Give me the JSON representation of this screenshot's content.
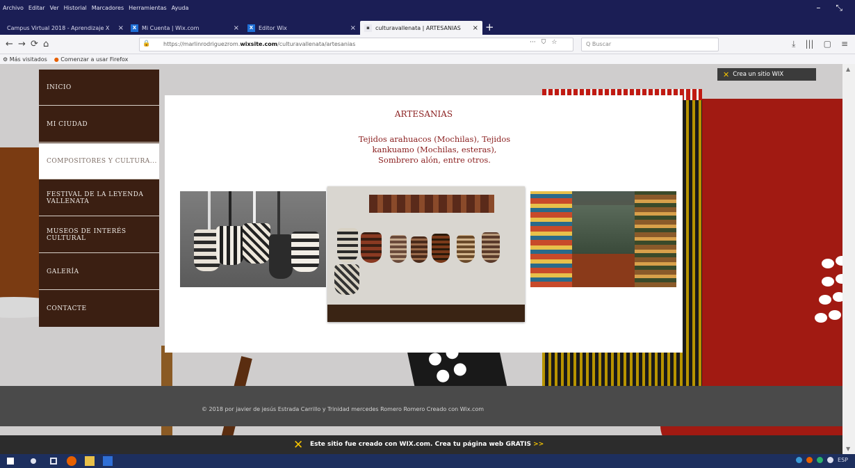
{
  "menubar": {
    "items": [
      "Archivo",
      "Editar",
      "Ver",
      "Historial",
      "Marcadores",
      "Herramientas",
      "Ayuda"
    ],
    "controls": [
      "–",
      "⤡"
    ]
  },
  "tabs": [
    {
      "label": "Campus Virtual 2018 - Aprendizaje X",
      "icon": "campus-favicon"
    },
    {
      "label": "Mi Cuenta | Wix.com",
      "icon": "wix-favicon"
    },
    {
      "label": "Editor Wix",
      "icon": "wix-favicon"
    },
    {
      "label": "culturavallenata | ARTESANIAS",
      "icon": "site-favicon"
    }
  ],
  "navbar": {
    "back": "←",
    "forward": "→",
    "reload": "⟳",
    "home": "⌂",
    "url_prefix": "https://marlinrodriguezrom.",
    "url_domain": "wixsite.com",
    "url_path": "/culturavallenata/artesanias",
    "zoom_lock": "🔒",
    "page_icons": [
      "···",
      "⛉",
      "☆"
    ],
    "search_placeholder": "Q Buscar",
    "right_buttons": [
      "⤓",
      "|||",
      "▢",
      "≡"
    ]
  },
  "bookmarks": {
    "items": [
      "Más visitados",
      "Comenzar a usar Firefox"
    ]
  },
  "sidenav": {
    "items": [
      {
        "label": "INICIO",
        "active": false
      },
      {
        "label": "MI CIUDAD",
        "active": false
      },
      {
        "label": "COMPOSITORES Y CULTURA...",
        "active": true
      },
      {
        "label": "FESTIVAL DE LA LEYENDA VALLENATA",
        "active": false
      },
      {
        "label": "MUSEOS DE INTERÉS CULTURAL",
        "active": false
      },
      {
        "label": "GALERÍA",
        "active": false
      },
      {
        "label": "CONTACTE",
        "active": false
      }
    ]
  },
  "content": {
    "title": "ARTESANIAS",
    "description": "Tejidos arahuacos (Mochilas), Tejidos kankuamo (Mochilas, esteras), Sombrero alón, entre otros."
  },
  "photos": [
    {
      "name": "mochilas-photo"
    },
    {
      "name": "mochilas-hanging-photo"
    },
    {
      "name": "artesanias-shop-photo"
    }
  ],
  "wix_badge": {
    "label": "Crea un sitio WIX"
  },
  "footer": {
    "text": "© 2018 por javier de jesús Estrada Carrillo y Trinidad mercedes Romero Romero Creado con Wix.com"
  },
  "wix_banner": {
    "text": "Este sitio fue creado con WIX.com. Crea tu página web GRATIS",
    "cta": ">>"
  },
  "taskbar": {
    "tray_text": "ESP"
  },
  "colors": {
    "nav_bg": "#3b1f12",
    "accent_title": "#8a1e1e",
    "browser_chrome": "#1b1e55",
    "wix_yellow": "#f4c300"
  }
}
